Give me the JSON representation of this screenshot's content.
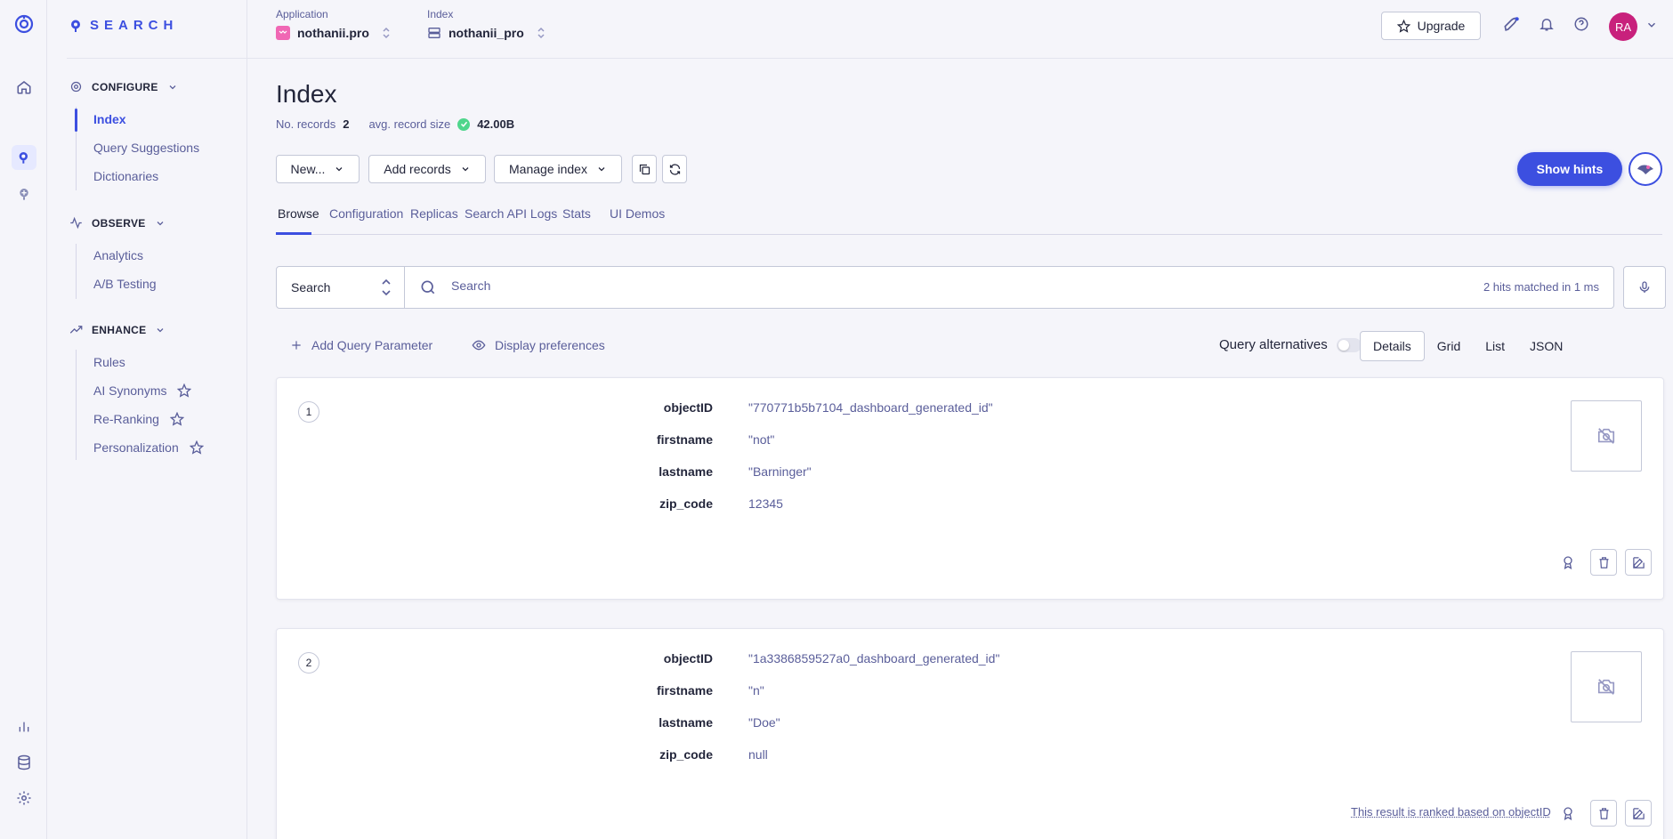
{
  "brand": {
    "name": "SEARCH"
  },
  "sidebar": {
    "configure": {
      "title": "CONFIGURE",
      "items": [
        "Index",
        "Query Suggestions",
        "Dictionaries"
      ]
    },
    "observe": {
      "title": "OBSERVE",
      "items": [
        "Analytics",
        "A/B Testing"
      ]
    },
    "enhance": {
      "title": "ENHANCE",
      "items": [
        "Rules",
        "AI Synonyms",
        "Re-Ranking",
        "Personalization"
      ]
    }
  },
  "topbar": {
    "application_label": "Application",
    "application_value": "nothanii.pro",
    "index_label": "Index",
    "index_value": "nothanii_pro",
    "upgrade_label": "Upgrade",
    "avatar_initials": "RA"
  },
  "main": {
    "title": "Index",
    "records_label": "No. records",
    "records_value": "2",
    "size_label": "avg. record size",
    "size_value": "42.00B",
    "buttons": {
      "new": "New...",
      "add_records": "Add records",
      "manage_index": "Manage index",
      "show_hints": "Show hints"
    },
    "tabs": [
      "Browse",
      "Configuration",
      "Replicas",
      "Search API Logs",
      "Stats",
      "UI Demos"
    ],
    "search": {
      "mode": "Search",
      "placeholder": "Search",
      "hits": "2 hits matched in 1 ms"
    },
    "toolbar": {
      "add_param": "Add Query Parameter",
      "display_prefs": "Display preferences",
      "query_alternatives": "Query alternatives",
      "views": [
        "Details",
        "Grid",
        "List",
        "JSON"
      ]
    },
    "hits": [
      {
        "number": "1",
        "attributes": [
          {
            "key": "objectID",
            "value": "\"770771b5b7104_dashboard_generated_id\""
          },
          {
            "key": "firstname",
            "value": "\"not\""
          },
          {
            "key": "lastname",
            "value": "\"Barninger\""
          },
          {
            "key": "zip_code",
            "value": "12345"
          }
        ]
      },
      {
        "number": "2",
        "attributes": [
          {
            "key": "objectID",
            "value": "\"1a3386859527a0_dashboard_generated_id\""
          },
          {
            "key": "firstname",
            "value": "\"n\""
          },
          {
            "key": "lastname",
            "value": "\"Doe\""
          },
          {
            "key": "zip_code",
            "value": "null"
          }
        ],
        "ranked_note": "This result is ranked based on objectID"
      }
    ]
  },
  "colors": {
    "accent": "#3c4fe0",
    "text": "#23263b",
    "muted": "#5a5e9a",
    "avatar": "#c8217c",
    "success": "#4fd68c"
  }
}
